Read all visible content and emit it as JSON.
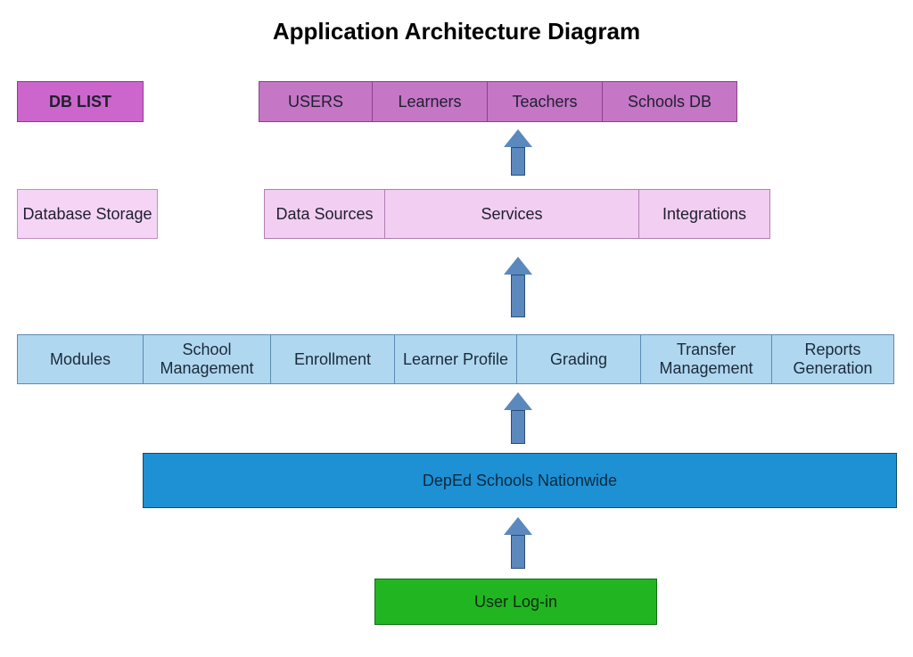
{
  "title": "Application Architecture Diagram",
  "row1": {
    "label": "DB LIST",
    "boxes": [
      "USERS",
      "Learners",
      "Teachers",
      "Schools DB"
    ]
  },
  "row2": {
    "label": "Database Storage",
    "boxes": [
      "Data Sources",
      "Services",
      "Integrations"
    ]
  },
  "row3": {
    "label": "Modules",
    "boxes": [
      "School Management",
      "Enrollment",
      "Learner Profile",
      "Grading",
      "Transfer Management",
      "Reports Generation"
    ]
  },
  "row4": {
    "label": "DepEd Schools Nationwide"
  },
  "row5": {
    "label": "User Log-in"
  },
  "colors": {
    "db_label": "#CC66CC",
    "db_box": "#C576C5",
    "ds": "#F2CEF2",
    "mod": "#B0D7F0",
    "schools": "#1E90D4",
    "login": "#22B522",
    "arrow": "#5B89BE"
  }
}
